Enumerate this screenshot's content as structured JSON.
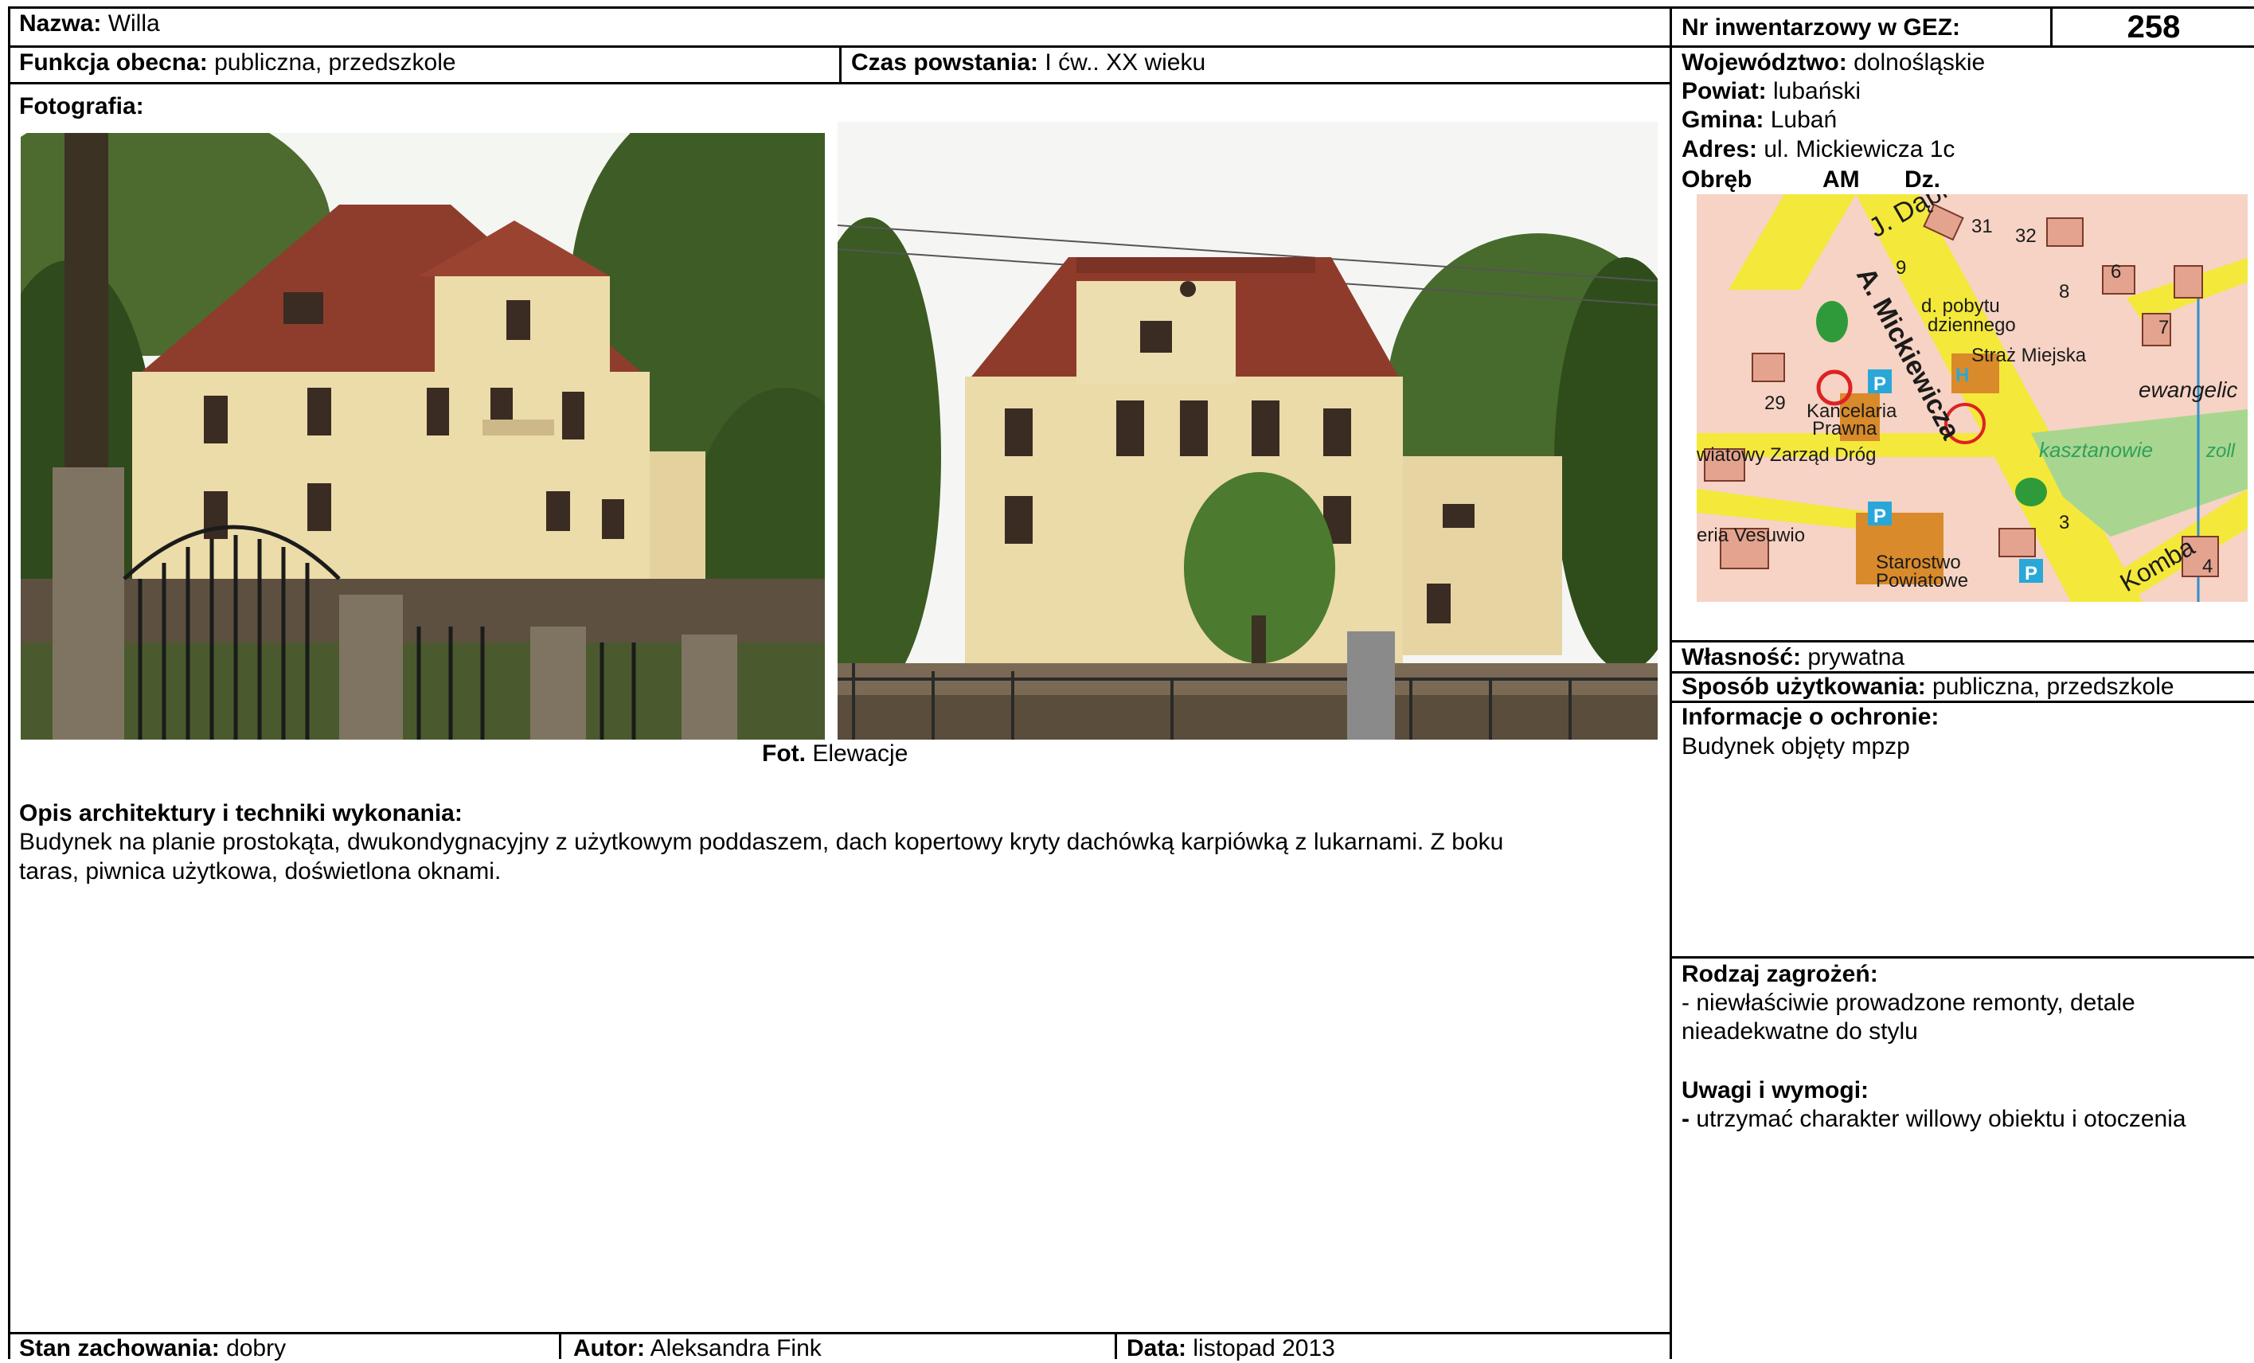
{
  "header": {
    "nazwa_label": "Nazwa:",
    "nazwa_value": "Willa",
    "nr_label": "Nr inwentarzowy w GEZ:",
    "nr_value": "258",
    "funkcja_label": "Funkcja obecna:",
    "funkcja_value": "publiczna, przedszkole",
    "czas_label": "Czas powstania:",
    "czas_value": "I ćw.. XX wieku"
  },
  "photos": {
    "section_label": "Fotografia:",
    "caption_bold": "Fot.",
    "caption_text": "Elewacje"
  },
  "description": {
    "heading": "Opis architektury i techniki wykonania:",
    "line1": "Budynek na planie prostokąta, dwukondygnacyjny z użytkowym poddaszem, dach kopertowy kryty dachówką karpiówką z lukarnami. Z boku",
    "line2": "taras, piwnica użytkowa, doświetlona oknami."
  },
  "location": {
    "woj_label": "Województwo:",
    "woj_value": "dolnośląskie",
    "powiat_label": "Powiat:",
    "powiat_value": "lubański",
    "gmina_label": "Gmina:",
    "gmina_value": "Lubań",
    "adres_label": "Adres:",
    "adres_value": "ul. Mickiewicza 1c",
    "obreb_label": "Obręb",
    "am_label": "AM",
    "dz_label": "Dz."
  },
  "map": {
    "street1": "J. Dąbr",
    "street2": "A. Mickiewicza",
    "street3": "Komba",
    "street4": "ewangelic",
    "street5": "kasztanowie",
    "label_pobytu1": "d. pobytu",
    "label_pobytu2": "dziennego",
    "label_straz": "Straż Miejska",
    "label_kancel1": "Kancelaria",
    "label_kancel2": "Prawna",
    "label_zarzad": "wiatowy Zarząd Dróg",
    "label_vesuwio": "eria Vesuwio",
    "label_starostwo1": "Starostwo",
    "label_starostwo2": "Powiatowe",
    "num1": "31",
    "num2": "32",
    "num3": "9",
    "num4": "8",
    "num5": "6",
    "num6": "7",
    "num7": "29",
    "num8": "4",
    "num9": "3",
    "parking": "P",
    "hospital": "H",
    "water": "zoll"
  },
  "right": {
    "wlasnosc_label": "Własność:",
    "wlasnosc_value": "prywatna",
    "sposob_label": "Sposób użytkowania:",
    "sposob_value": "publiczna, przedszkole",
    "ochrona_label": "Informacje o ochronie:",
    "ochrona_value": "Budynek objęty mpzp",
    "zagrozenia_label": "Rodzaj zagrożeń:",
    "zagrozenia_line1": "- niewłaściwie prowadzone remonty, detale",
    "zagrozenia_line2": "nieadekwatne do stylu",
    "uwagi_label": "Uwagi i wymogi:",
    "uwagi_dash": "-",
    "uwagi_value": "utrzymać charakter willowy obiektu i otoczenia"
  },
  "footer": {
    "stan_label": "Stan zachowania:",
    "stan_value": "dobry",
    "autor_label": "Autor:",
    "autor_value": "Aleksandra Fink",
    "data_label": "Data:",
    "data_value": "listopad 2013"
  }
}
